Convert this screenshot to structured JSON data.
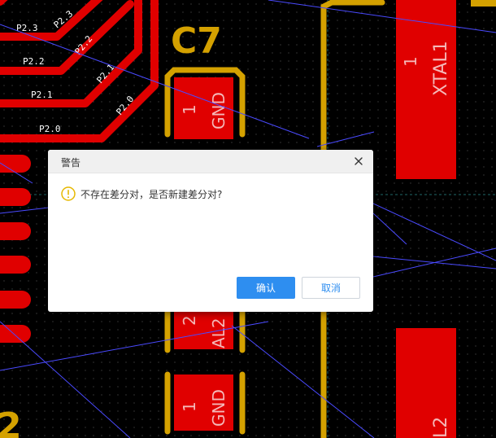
{
  "pcb": {
    "trace_labels": [
      "P2.3",
      "P2.2",
      "P2.1",
      "P2.0",
      "P2.3",
      "P2.2",
      "P2.1",
      "P2.0"
    ],
    "designators": [
      "C7",
      "2"
    ],
    "pad_numbers": [
      "1",
      "1",
      "2",
      "1"
    ],
    "nets": [
      "GND",
      "GND",
      "AL2"
    ],
    "component_labels": [
      "XTAL1",
      "L2"
    ],
    "colors": {
      "background": "#000000",
      "copper": "#e00000",
      "silkscreen": "#d4a100",
      "ratsnest": "#4a4aff"
    }
  },
  "dialog": {
    "title": "警告",
    "close_label": "✕",
    "message": "不存在差分对，是否新建差分对?",
    "confirm_label": "确认",
    "cancel_label": "取消",
    "warning_color": "#e6b800",
    "primary_color": "#2e8ef0"
  }
}
